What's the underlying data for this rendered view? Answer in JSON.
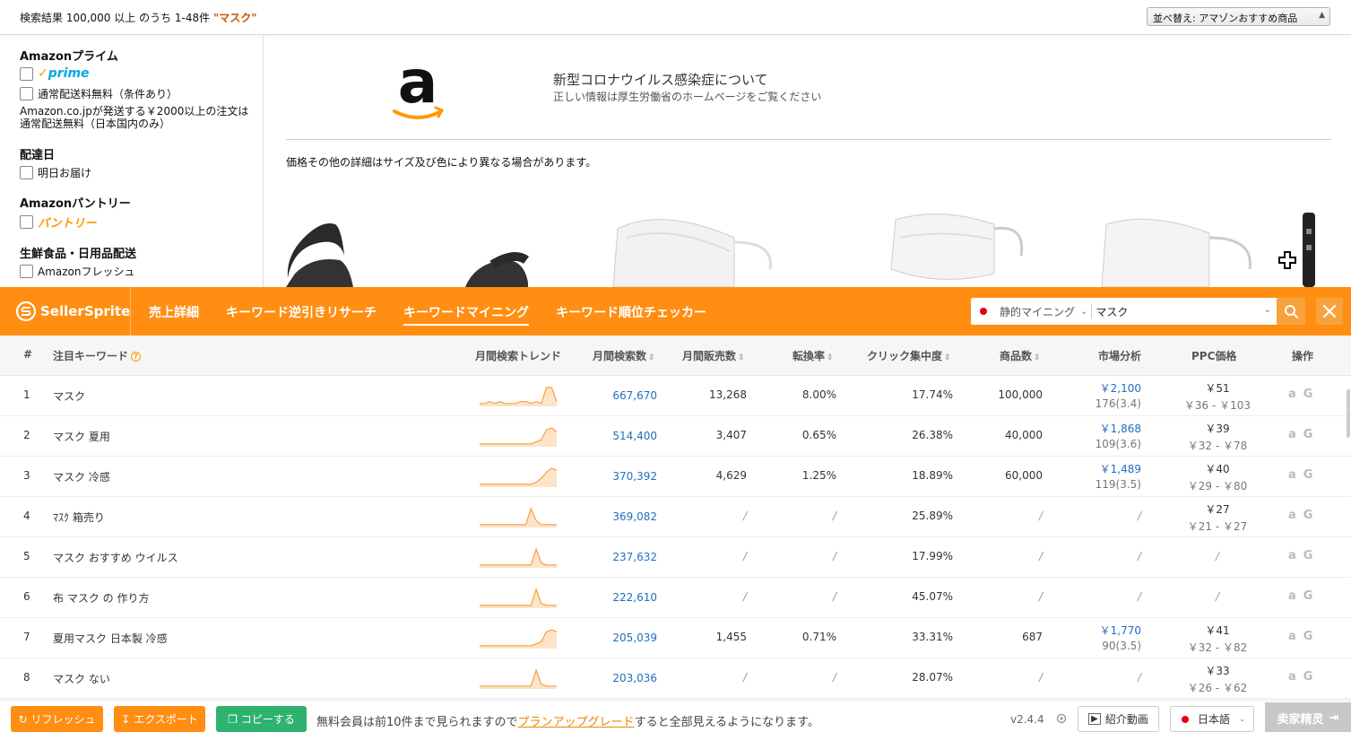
{
  "results": {
    "text": "検索結果 100,000 以上 のうち 1-48件 ",
    "query": "\"マスク\"",
    "sort_label": "並べ替え: アマゾンおすすめ商品"
  },
  "sidebar": {
    "prime_heading": "Amazonプライム",
    "prime_logo": "prime",
    "free_shipping": "通常配送料無料（条件あり）",
    "free_note": "Amazon.co.jpが発送する￥2000以上の注文は通常配送無料（日本国内のみ）",
    "delivery_heading": "配達日",
    "tomorrow": "明日お届け",
    "pantry_heading": "Amazonパントリー",
    "pantry_logo": "パントリー",
    "fresh_heading": "生鮮食品・日用品配送",
    "fresh": "Amazonフレッシュ"
  },
  "banner": {
    "title": "新型コロナウイルス感染症について",
    "subtitle": "正しい情報は厚生労働省のホームページをご覧ください",
    "price_note": "価格その他の詳細はサイズ及び色により異なる場合があります。"
  },
  "toolbar": {
    "logo": "SellerSprite",
    "tabs": [
      "売上詳細",
      "キーワード逆引きリサーチ",
      "キーワードマイニング",
      "キーワード順位チェッカー"
    ],
    "mode": "静的マイニング",
    "keyword": "マスク",
    "accent": "#ff8e12"
  },
  "table": {
    "headers": {
      "index": "#",
      "keyword": "注目キーワード",
      "trend": "月間検索トレンド",
      "searches": "月間検索数",
      "sales": "月間販売数",
      "conversion": "転換率",
      "click": "クリック集中度",
      "products": "商品数",
      "market": "市場分析",
      "ppc": "PPC価格",
      "ops": "操作"
    },
    "rows": [
      {
        "n": "1",
        "kw": "マスク",
        "search": "667,670",
        "sales": "13,268",
        "conv": "8.00%",
        "click": "17.74%",
        "prod": "100,000",
        "m1": "￥2,100",
        "m2": "176(3.4)",
        "p1": "￥51",
        "p2": "￥36 - ￥103",
        "trend": [
          1,
          1,
          2,
          1,
          2,
          1,
          1,
          1,
          2,
          2,
          1,
          2,
          1,
          9,
          9,
          2
        ]
      },
      {
        "n": "2",
        "kw": "マスク 夏用",
        "search": "514,400",
        "sales": "3,407",
        "conv": "0.65%",
        "click": "26.38%",
        "prod": "40,000",
        "m1": "￥1,868",
        "m2": "109(3.6)",
        "p1": "￥39",
        "p2": "￥32 - ￥78",
        "trend": [
          1,
          1,
          1,
          1,
          1,
          1,
          1,
          1,
          1,
          1,
          1,
          2,
          3,
          8,
          9,
          7
        ]
      },
      {
        "n": "3",
        "kw": "マスク 冷感",
        "search": "370,392",
        "sales": "4,629",
        "conv": "1.25%",
        "click": "18.89%",
        "prod": "60,000",
        "m1": "￥1,489",
        "m2": "119(3.5)",
        "p1": "￥40",
        "p2": "￥29 - ￥80",
        "trend": [
          1,
          1,
          1,
          1,
          1,
          1,
          1,
          1,
          1,
          1,
          1,
          2,
          4,
          7,
          9,
          8
        ]
      },
      {
        "n": "4",
        "kw": "ﾏｽｸ 箱売り",
        "search": "369,082",
        "sales": "/",
        "conv": "/",
        "click": "25.89%",
        "prod": "/",
        "m1": "",
        "m2": "/",
        "p1": "￥27",
        "p2": "￥21 - ￥27",
        "trend": [
          1,
          1,
          1,
          1,
          1,
          1,
          1,
          1,
          1,
          1,
          9,
          3,
          1,
          1,
          1,
          1
        ]
      },
      {
        "n": "5",
        "kw": "マスク おすすめ ウイルス",
        "search": "237,632",
        "sales": "/",
        "conv": "/",
        "click": "17.99%",
        "prod": "/",
        "m1": "",
        "m2": "/",
        "p1": "",
        "p2": "/",
        "trend": [
          1,
          1,
          1,
          1,
          1,
          1,
          1,
          1,
          1,
          1,
          1,
          9,
          2,
          1,
          1,
          1
        ]
      },
      {
        "n": "6",
        "kw": "布 マスク の 作り方",
        "search": "222,610",
        "sales": "/",
        "conv": "/",
        "click": "45.07%",
        "prod": "/",
        "m1": "",
        "m2": "/",
        "p1": "",
        "p2": "/",
        "trend": [
          1,
          1,
          1,
          1,
          1,
          1,
          1,
          1,
          1,
          1,
          1,
          9,
          2,
          1,
          1,
          1
        ]
      },
      {
        "n": "7",
        "kw": "夏用マスク 日本製 冷感",
        "search": "205,039",
        "sales": "1,455",
        "conv": "0.71%",
        "click": "33.31%",
        "prod": "687",
        "m1": "￥1,770",
        "m2": "90(3.5)",
        "p1": "￥41",
        "p2": "￥32 - ￥82",
        "trend": [
          1,
          1,
          1,
          1,
          1,
          1,
          1,
          1,
          1,
          1,
          1,
          2,
          3,
          8,
          9,
          8
        ]
      },
      {
        "n": "8",
        "kw": "マスク ない",
        "search": "203,036",
        "sales": "/",
        "conv": "/",
        "click": "28.07%",
        "prod": "/",
        "m1": "",
        "m2": "/",
        "p1": "￥33",
        "p2": "￥26 - ￥62",
        "trend": [
          1,
          1,
          1,
          1,
          1,
          1,
          1,
          1,
          1,
          1,
          1,
          9,
          2,
          1,
          1,
          1
        ]
      }
    ]
  },
  "footer": {
    "refresh": "リフレッシュ",
    "export": "エクスポート",
    "copy": "コピーする",
    "msg_pre": "無料会員は前10件まで見られますので",
    "msg_link": "プランアップグレード",
    "msg_post": "すると全部見えるようになります。",
    "version": "v2.4.4",
    "video": "紹介動画",
    "lang": "日本語",
    "seller": "卖家精灵"
  }
}
